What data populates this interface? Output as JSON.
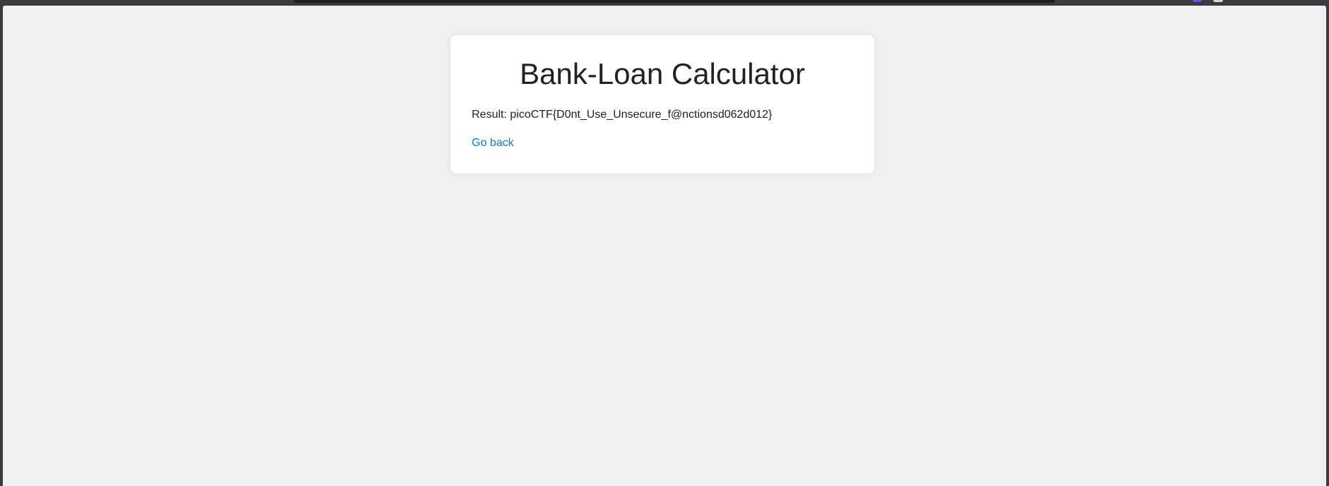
{
  "card": {
    "title": "Bank-Loan Calculator",
    "result_label": "Result:",
    "result_value": "picoCTF{D0nt_Use_Unsecure_f@nctionsd062d012}",
    "back_link_label": "Go back"
  },
  "colors": {
    "page_background": "#f0f0f0",
    "card_background": "#ffffff",
    "link": "#0a7bd8",
    "text": "#222222",
    "browser_chrome": "#3a3a3f"
  }
}
